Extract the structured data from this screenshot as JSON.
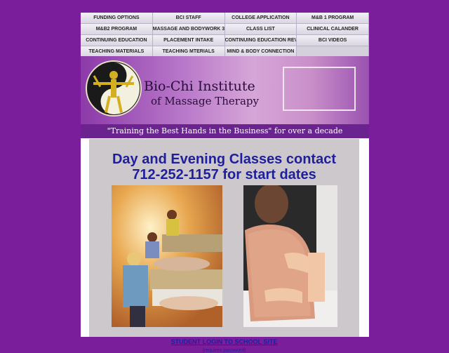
{
  "nav": {
    "items": [
      "FUNDING OPTIONS",
      "BCI STAFF",
      "COLLEGE APPLICATION",
      "M&B 1 PROGRAM",
      "M&B2 PROGRAM",
      "MASSAGE AND BODYWORK 3",
      "CLASS LIST",
      "CLINICAL CALANDER",
      "CONTINUING EDUCATION",
      "PLACEMENT INTAKE",
      "CONTINUING EDUCATION REV",
      "BCI VIDEOS",
      "TEACHING MATERIALS",
      "TEACHING MTERIALS",
      "MIND & BODY CONNECTION"
    ]
  },
  "banner": {
    "title": "Bio-Chi Institute",
    "subtitle": "of Massage Therapy",
    "tagline": "\"Training the Best Hands in the Business\" for over a decade"
  },
  "main": {
    "headline_line1": "Day and Evening Classes contact",
    "headline_line2": "712-252-1157 for start dates",
    "login_label": "STUDENT LOGIN TO SCHOOL SITE",
    "login_note": "(requires password)"
  },
  "colors": {
    "background": "#7a1e9c",
    "banner_strip": "#6b2390",
    "link": "#1f1f9e",
    "content_panel": "#ccc8cb"
  }
}
